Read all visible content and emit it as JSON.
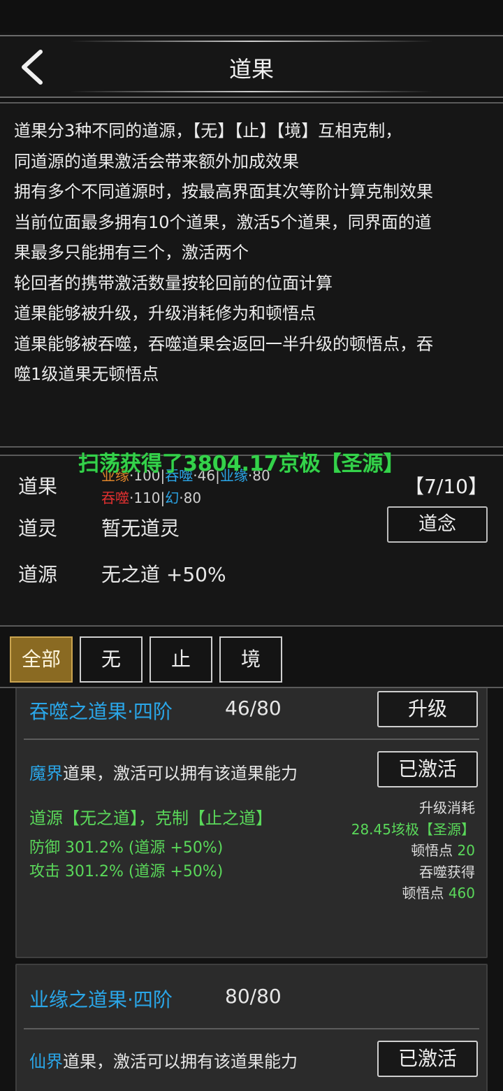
{
  "header": {
    "title": "道果"
  },
  "info_lines": [
    "道果分3种不同的道源，【无】【止】【境】互相克制，",
    "同道源的道果激活会带来额外加成效果",
    "拥有多个不同道源时，按最高界面其次等阶计算克制效果",
    "当前位面最多拥有10个道果，激活5个道果，同界面的道",
    "果最多只能拥有三个，激活两个",
    "轮回者的携带激活数量按轮回前的位面计算",
    "道果能够被升级，升级消耗修为和顿悟点",
    "道果能够被吞噬，吞噬道果会返回一半升级的顿悟点，吞",
    "噬1级道果无顿悟点"
  ],
  "summary": {
    "daoguo_label": "道果",
    "count": "【7/10】",
    "chips_row1": [
      {
        "name": "业缘",
        "sep": "·",
        "value": "100"
      },
      {
        "name": "吞噬",
        "sep": "·",
        "value": "46"
      },
      {
        "name": "业缘",
        "sep": "·",
        "value": "80"
      }
    ],
    "chips_row2": [
      {
        "name": "吞噬",
        "sep": "·",
        "value": "110"
      },
      {
        "name": "幻",
        "sep": "·",
        "value": "80"
      }
    ],
    "daoling_label": "道灵",
    "daoling_value": "暂无道灵",
    "daonian_button": "道念",
    "daoyuan_label": "道源",
    "daoyuan_value": "无之道 +50%",
    "toast": "扫荡获得了3804.17京极【圣源】"
  },
  "tabs": [
    "全部",
    "无",
    "止",
    "境"
  ],
  "active_tab": "全部",
  "cards": [
    {
      "name": "吞噬之道果·四阶",
      "progress": "46/80",
      "upgrade_button": "升级",
      "realm": "魔界",
      "desc": "道果，激活可以拥有该道果能力",
      "activated_button": "已激活",
      "source": "道源【无之道】，克制【止之道】",
      "def": "防御 301.2% (道源 +50%)",
      "atk": "攻击 301.2% (道源 +50%)",
      "cost_title": "升级消耗",
      "cost_amount": "28.45垓极【圣源】",
      "cost_points_label": "顿悟点",
      "cost_points": "20",
      "devour_title": "吞噬获得",
      "devour_label": "顿悟点",
      "devour_points": "460"
    },
    {
      "name": "业缘之道果·四阶",
      "progress": "80/80",
      "realm": "仙界",
      "desc": "道果，激活可以拥有该道果能力",
      "activated_button": "已激活"
    }
  ],
  "colors": {
    "accent_blue": "#2aa6e8",
    "green": "#5ad85a",
    "tab_active": "#8a6a22",
    "red": "#e03030",
    "orange": "#e0852a"
  }
}
